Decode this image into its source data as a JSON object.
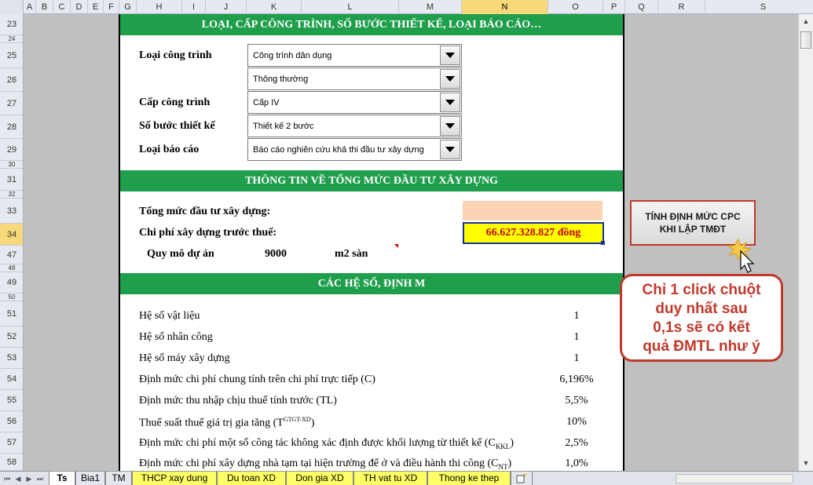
{
  "columns": [
    "A",
    "B",
    "C",
    "D",
    "E",
    "F",
    "G",
    "H",
    "I",
    "J",
    "K",
    "L",
    "M",
    "N",
    "O",
    "P",
    "Q",
    "R",
    "S"
  ],
  "selected_column": "N",
  "rows": [
    "23",
    "24",
    "25",
    "26",
    "27",
    "28",
    "29",
    "30",
    "31",
    "32",
    "33",
    "34",
    "47",
    "48",
    "49",
    "50",
    "51",
    "52",
    "53",
    "54",
    "55",
    "56",
    "57",
    "58"
  ],
  "selected_row": "34",
  "section1": {
    "title": "LOẠI, CẤP CÔNG TRÌNH, SỐ BƯỚC THIẾT KẾ, LOẠI BÁO CÁO…",
    "loai_cong_trinh_label": "Loại công trình",
    "loai_cong_trinh_value": "Công trình dân dụng",
    "loai_cong_trinh_sub_value": "Thông thường",
    "cap_cong_trinh_label": "Cấp công trình",
    "cap_cong_trinh_value": "Cấp IV",
    "so_buoc_label": "Số bước thiết kế",
    "so_buoc_value": "Thiết kế 2 bước",
    "loai_bao_cao_label": "Loại báo cáo",
    "loai_bao_cao_value": "Báo cáo nghiên cứu khả thi đầu tư xây dựng"
  },
  "section2": {
    "title": "THÔNG TIN VỀ TỔNG MỨC ĐẦU TƯ XÂY DỰNG",
    "tong_muc_label": "Tổng mức đầu tư xây dựng:",
    "chi_phi_label": "Chi phí xây dựng trước thuế:",
    "chi_phi_value": "66.627.328.827 đồng",
    "quy_mo_label": "Quy mô dự án",
    "quy_mo_value": "9000",
    "quy_mo_unit": "m2 sàn"
  },
  "section3": {
    "title": "CÁC HỆ SỐ, ĐỊNH M",
    "items": [
      {
        "label": "Hệ số vật liệu",
        "value": "1"
      },
      {
        "label": "Hệ số nhân công",
        "value": "1"
      },
      {
        "label": "Hệ số máy xây dựng",
        "value": "1"
      },
      {
        "label": "Định mức chi phí chung tính trên chi phí trực tiếp (C)",
        "value": "6,196%"
      },
      {
        "label": "Định mức thu nhập chịu thuế tính trước (TL)",
        "value": "5,5%"
      },
      {
        "label": "Thuế suất thuế giá trị gia tăng (T",
        "sup": "GTGT-XD",
        "tail": ")",
        "value": "10%"
      },
      {
        "label": "Định mức chi phí một số công tác không xác định được khối lượng từ thiết kế (C",
        "sub": "KKL",
        "tail": ")",
        "value": "2,5%"
      },
      {
        "label": "Định mức chi phí xây dựng nhà tạm tại hiện trường để ở và điều hành thi công (C",
        "sub": "NT",
        "tail": ")",
        "value": "1,0%"
      }
    ]
  },
  "calc_button": {
    "line1": "TÍNH ĐỊNH MỨC CPC",
    "line2": "KHI LẬP TMĐT"
  },
  "callout": {
    "line1": "Chỉ 1 click chuột",
    "line2": "duy nhất sau",
    "line3": "0,1s sẽ có kết",
    "line4": "quả ĐMTL như ý"
  },
  "sheet_tabs": [
    "Ts",
    "Bia1",
    "TM",
    "THCP xay dung",
    "Du toan XD",
    "Don gia XD",
    "TH vat tu XD",
    "Thong ke thep"
  ],
  "active_tab": "Ts",
  "colors": {
    "banner": "#1f9e4b",
    "highlight": "#ffff00",
    "value_red": "#c00000",
    "callout_red": "#c0392b",
    "peach": "#fbd4b4"
  }
}
